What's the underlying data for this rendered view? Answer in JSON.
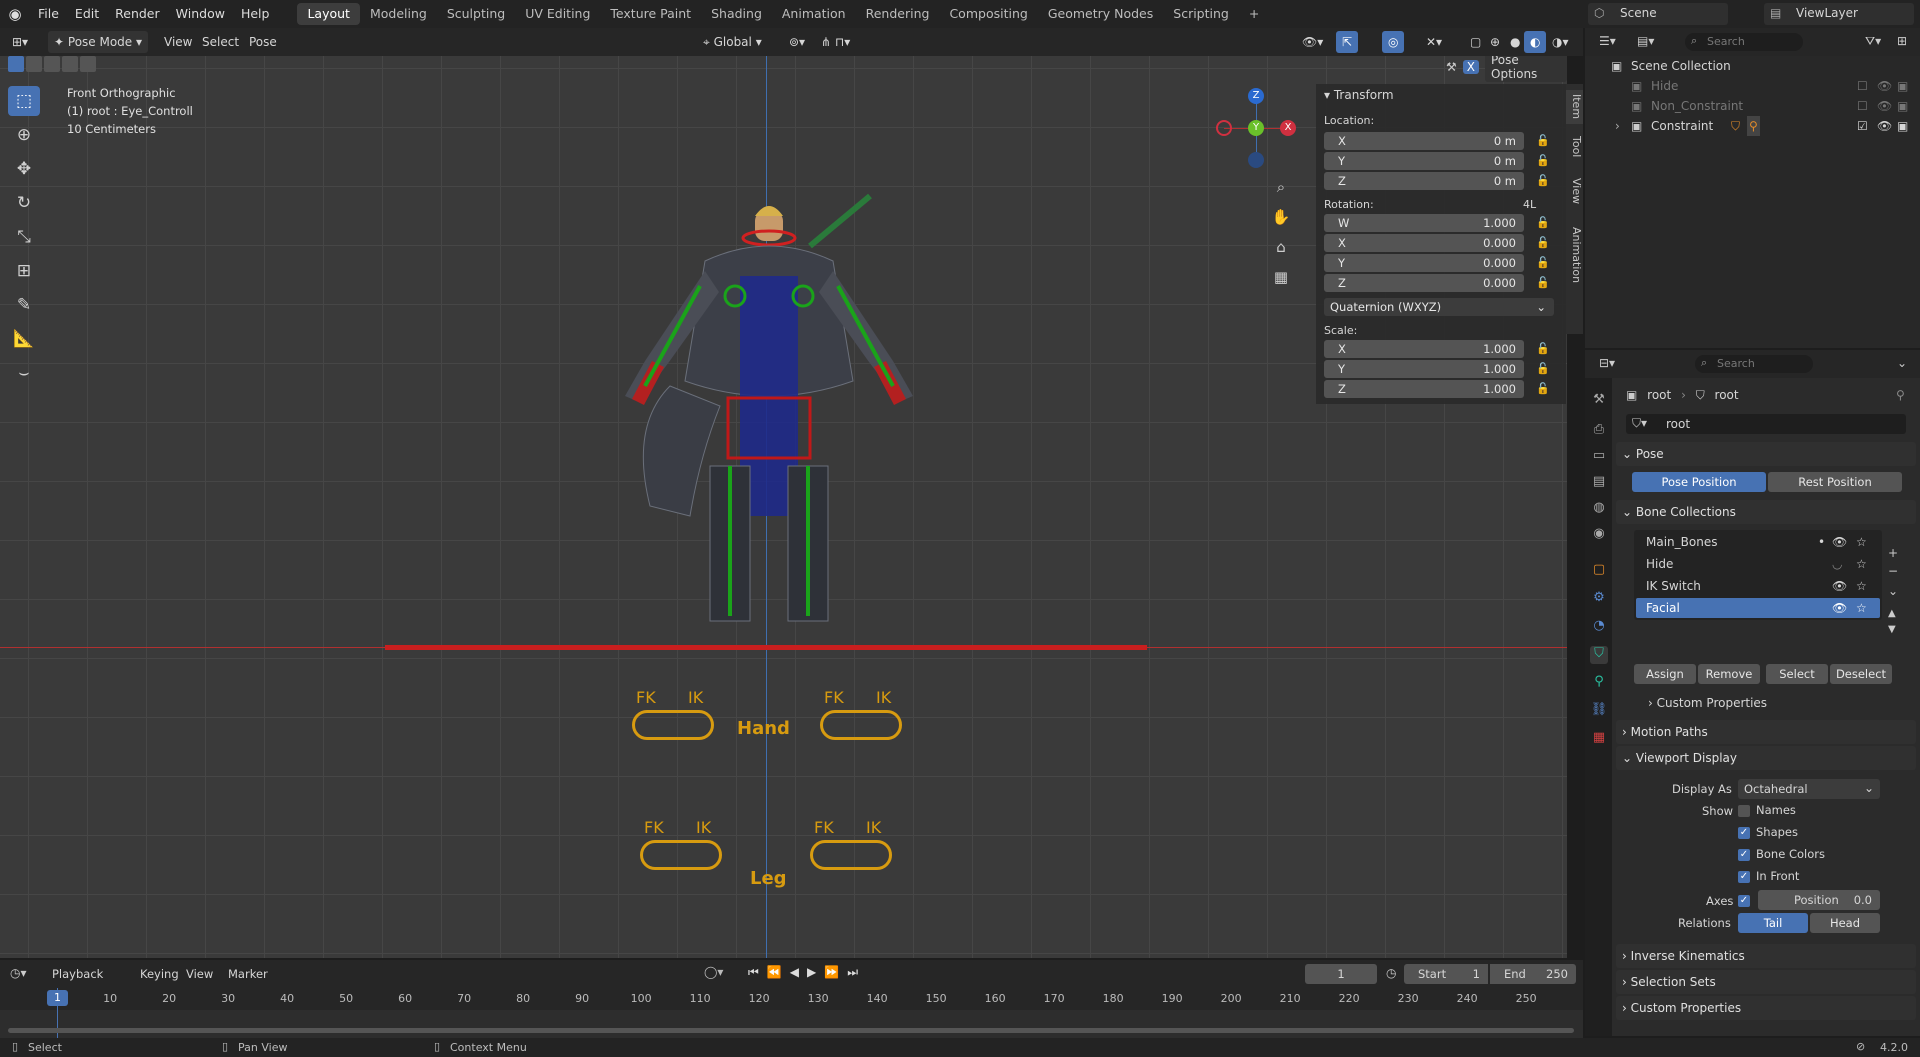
{
  "topbar": {
    "menus": [
      "File",
      "Edit",
      "Render",
      "Window",
      "Help"
    ],
    "workspaces": [
      "Layout",
      "Modeling",
      "Sculpting",
      "UV Editing",
      "Texture Paint",
      "Shading",
      "Animation",
      "Rendering",
      "Compositing",
      "Geometry Nodes",
      "Scripting"
    ],
    "active_workspace": "Layout",
    "scene": "Scene",
    "view_layer": "ViewLayer"
  },
  "viewport_header": {
    "mode": "Pose Mode",
    "menus": [
      "View",
      "Select",
      "Pose"
    ],
    "transform_orientation": "Global",
    "pose_options": "Pose Options"
  },
  "overlay": {
    "view_name": "Front Orthographic",
    "active": "(1) root : Eye_Controll",
    "scale": "10 Centimeters"
  },
  "gizmo": {
    "x": "X",
    "y": "Y",
    "z": "Z"
  },
  "rig_labels": {
    "fk": "FK",
    "ik": "IK",
    "hand": "Hand",
    "leg": "Leg"
  },
  "npanel": {
    "title": "Transform",
    "location_label": "Location:",
    "location": [
      {
        "axis": "X",
        "value": "0 m"
      },
      {
        "axis": "Y",
        "value": "0 m"
      },
      {
        "axis": "Z",
        "value": "0 m"
      }
    ],
    "rotation_label": "Rotation:",
    "rotation_mode_tag": "4L",
    "rotation": [
      {
        "axis": "W",
        "value": "1.000"
      },
      {
        "axis": "X",
        "value": "0.000"
      },
      {
        "axis": "Y",
        "value": "0.000"
      },
      {
        "axis": "Z",
        "value": "0.000"
      }
    ],
    "rotation_mode": "Quaternion (WXYZ)",
    "scale_label": "Scale:",
    "scale": [
      {
        "axis": "X",
        "value": "1.000"
      },
      {
        "axis": "Y",
        "value": "1.000"
      },
      {
        "axis": "Z",
        "value": "1.000"
      }
    ],
    "tabs": [
      "Item",
      "Tool",
      "View",
      "Animation"
    ]
  },
  "outliner": {
    "search_placeholder": "Search",
    "items": [
      {
        "label": "Scene Collection"
      },
      {
        "label": "Hide"
      },
      {
        "label": "Non_Constraint"
      },
      {
        "label": "Constraint"
      }
    ]
  },
  "properties": {
    "search_placeholder": "Search",
    "breadcrumb": [
      "root",
      "root"
    ],
    "name": "root",
    "pose_section": "Pose",
    "pose_position": "Pose Position",
    "rest_position": "Rest Position",
    "bone_collections_section": "Bone Collections",
    "collections": [
      {
        "name": "Main_Bones"
      },
      {
        "name": "Hide"
      },
      {
        "name": "IK Switch"
      },
      {
        "name": "Facial"
      }
    ],
    "assign": "Assign",
    "remove": "Remove",
    "select": "Select",
    "deselect": "Deselect",
    "custom_properties_sub": "Custom Properties",
    "motion_paths": "Motion Paths",
    "viewport_display": "Viewport Display",
    "display_as_label": "Display As",
    "display_as": "Octahedral",
    "show_label": "Show",
    "names": "Names",
    "shapes": "Shapes",
    "bone_colors": "Bone Colors",
    "in_front": "In Front",
    "axes_label": "Axes",
    "position_label": "Position",
    "position_value": "0.0",
    "relations_label": "Relations",
    "tail": "Tail",
    "head": "Head",
    "inverse_kinematics": "Inverse Kinematics",
    "selection_sets": "Selection Sets",
    "custom_properties": "Custom Properties"
  },
  "timeline": {
    "menus": [
      "Playback",
      "Keying",
      "View",
      "Marker"
    ],
    "current_frame": "1",
    "start_label": "Start",
    "start": "1",
    "end_label": "End",
    "end": "250",
    "ticks": [
      "1",
      "10",
      "20",
      "30",
      "40",
      "50",
      "60",
      "70",
      "80",
      "90",
      "100",
      "110",
      "120",
      "130",
      "140",
      "150",
      "160",
      "170",
      "180",
      "190",
      "200",
      "210",
      "220",
      "230",
      "240",
      "250"
    ]
  },
  "status": {
    "select": "Select",
    "pan": "Pan View",
    "context": "Context Menu",
    "version": "4.2.0"
  }
}
